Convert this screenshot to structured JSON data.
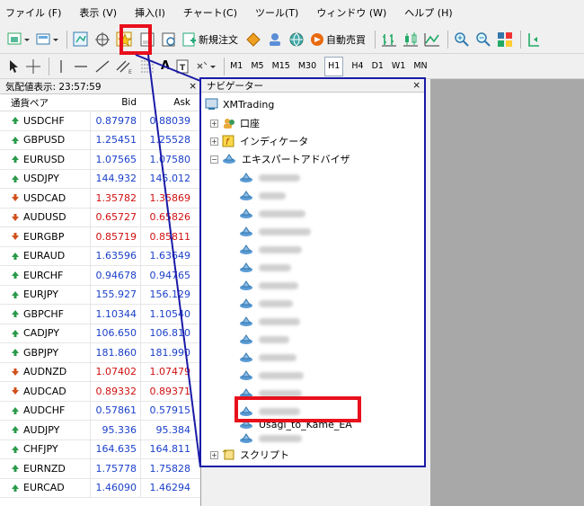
{
  "menu": [
    "ファイル (F)",
    "表示 (V)",
    "挿入(I)",
    "チャート(C)",
    "ツール(T)",
    "ウィンドウ (W)",
    "ヘルプ (H)"
  ],
  "toolbar": {
    "new_order": "新規注文",
    "auto_trading": "自動売買",
    "timeframes": [
      "M1",
      "M5",
      "M15",
      "M30",
      "H1",
      "H4",
      "D1",
      "W1",
      "MN"
    ],
    "active_timeframe": "H1",
    "text_tool": "A"
  },
  "quotes": {
    "title": "気配値表示: 23:57:59",
    "close": "×",
    "columns": {
      "symbol": "通貨ペア",
      "bid": "Bid",
      "ask": "Ask"
    },
    "rows": [
      {
        "symbol": "USDCHF",
        "bid": "0.87978",
        "ask": "0.88039",
        "dir": "up"
      },
      {
        "symbol": "GBPUSD",
        "bid": "1.25451",
        "ask": "1.25528",
        "dir": "up"
      },
      {
        "symbol": "EURUSD",
        "bid": "1.07565",
        "ask": "1.07580",
        "dir": "up"
      },
      {
        "symbol": "USDJPY",
        "bid": "144.932",
        "ask": "145.012",
        "dir": "up"
      },
      {
        "symbol": "USDCAD",
        "bid": "1.35782",
        "ask": "1.35869",
        "dir": "down"
      },
      {
        "symbol": "AUDUSD",
        "bid": "0.65727",
        "ask": "0.65826",
        "dir": "down"
      },
      {
        "symbol": "EURGBP",
        "bid": "0.85719",
        "ask": "0.85811",
        "dir": "down"
      },
      {
        "symbol": "EURAUD",
        "bid": "1.63596",
        "ask": "1.63649",
        "dir": "up"
      },
      {
        "symbol": "EURCHF",
        "bid": "0.94678",
        "ask": "0.94765",
        "dir": "up"
      },
      {
        "symbol": "EURJPY",
        "bid": "155.927",
        "ask": "156.129",
        "dir": "up"
      },
      {
        "symbol": "GBPCHF",
        "bid": "1.10344",
        "ask": "1.10540",
        "dir": "up"
      },
      {
        "symbol": "CADJPY",
        "bid": "106.650",
        "ask": "106.810",
        "dir": "up"
      },
      {
        "symbol": "GBPJPY",
        "bid": "181.860",
        "ask": "181.990",
        "dir": "up"
      },
      {
        "symbol": "AUDNZD",
        "bid": "1.07402",
        "ask": "1.07479",
        "dir": "down"
      },
      {
        "symbol": "AUDCAD",
        "bid": "0.89332",
        "ask": "0.89371",
        "dir": "down"
      },
      {
        "symbol": "AUDCHF",
        "bid": "0.57861",
        "ask": "0.57915",
        "dir": "up"
      },
      {
        "symbol": "AUDJPY",
        "bid": "95.336",
        "ask": "95.384",
        "dir": "up"
      },
      {
        "symbol": "CHFJPY",
        "bid": "164.635",
        "ask": "164.811",
        "dir": "up"
      },
      {
        "symbol": "EURNZD",
        "bid": "1.75778",
        "ask": "1.75828",
        "dir": "up"
      },
      {
        "symbol": "EURCAD",
        "bid": "1.46090",
        "ask": "1.46294",
        "dir": "up"
      }
    ]
  },
  "navigator": {
    "title": "ナビゲーター",
    "close": "×",
    "root": "XMTrading",
    "accounts": "口座",
    "indicators": "インディケータ",
    "experts": "エキスパートアドバイザ",
    "selected_ea": "Usagi_to_Kame_EA",
    "scripts": "スクリプト"
  },
  "colors": {
    "highlight": "#e8101c",
    "navbox": "#1a1aa8",
    "bid_up": "#1a3fc9",
    "bid_down": "#d01010"
  }
}
